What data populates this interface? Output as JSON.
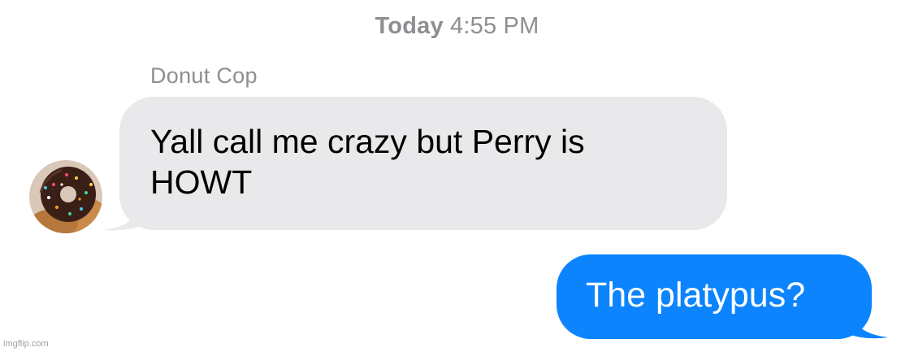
{
  "timestamp": {
    "day": "Today",
    "time": "4:55 PM"
  },
  "messages": [
    {
      "direction": "incoming",
      "sender": "Donut Cop",
      "avatar_icon": "donut-avatar-icon",
      "text": "Yall call me crazy but Perry is\nHOWT"
    },
    {
      "direction": "outgoing",
      "text": "The platypus?"
    }
  ],
  "colors": {
    "incoming_bubble": "#e9e9eb",
    "outgoing_bubble": "#0b84fe",
    "meta_text": "#8e8e93"
  },
  "watermark": "imgflip.com"
}
